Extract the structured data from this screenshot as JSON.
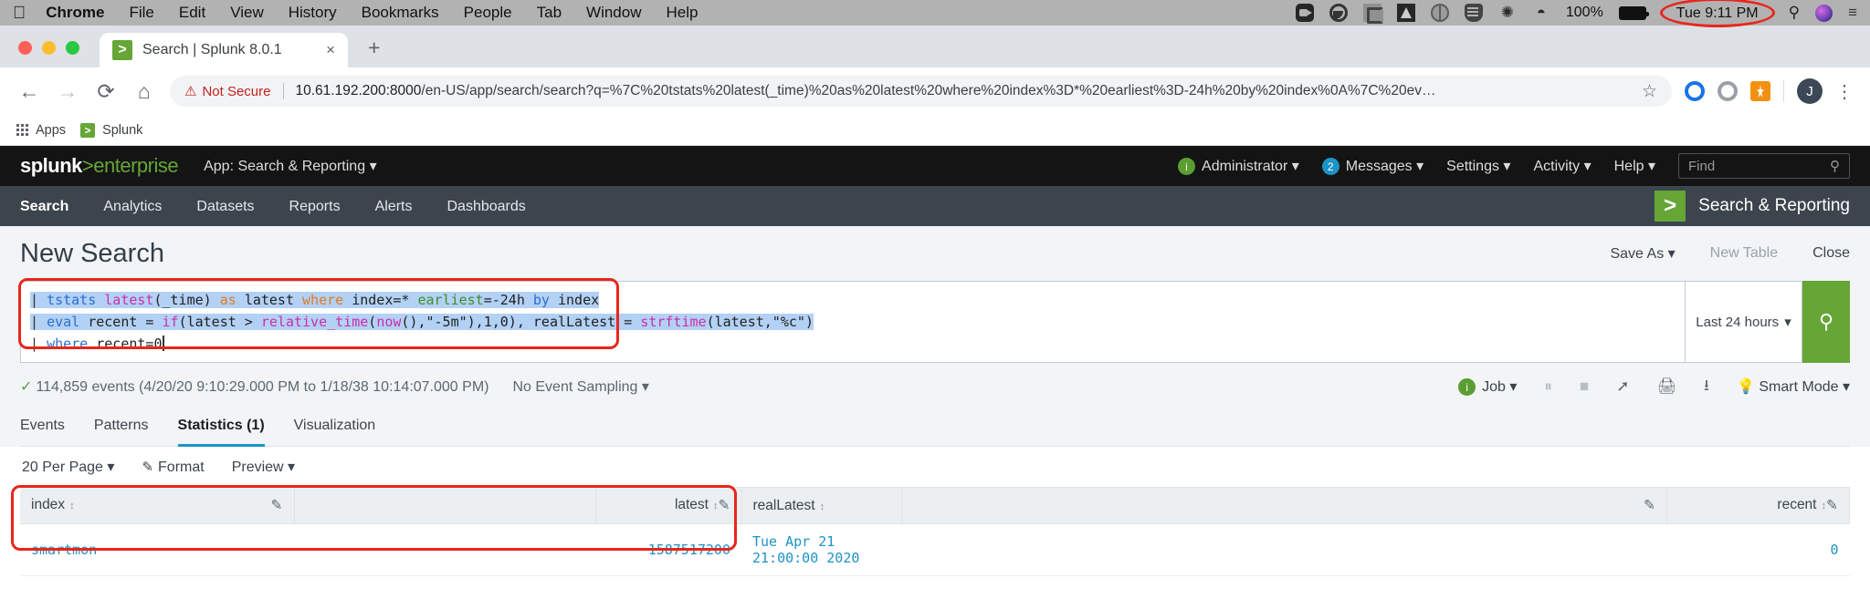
{
  "os_menubar": {
    "apple_icon": "apple-icon",
    "items": [
      "Chrome",
      "File",
      "Edit",
      "View",
      "History",
      "Bookmarks",
      "People",
      "Tab",
      "Window",
      "Help"
    ],
    "active_app": "Chrome",
    "tray_icons": [
      "zoom-icon",
      "circle-icon",
      "c-icon",
      "google-drive-icon",
      "globe-icon",
      "shield-icon",
      "bluetooth-icon",
      "wifi-icon"
    ],
    "battery_percent": "100%",
    "clock": "Tue 9:11 PM",
    "spotlight_icon": "search-icon",
    "siri_icon": "siri-icon",
    "control_center_icon": "list-icon"
  },
  "browser": {
    "tab": {
      "title": "Search | Splunk 8.0.1",
      "favicon": "splunk-favicon",
      "close": "×"
    },
    "new_tab_label": "+",
    "nav": {
      "back": "←",
      "forward": "→",
      "reload": "⟳",
      "home": "⌂"
    },
    "security_label": "Not Secure",
    "security_icon": "warning-triangle-icon",
    "url_domain": "10.61.192.200:8000",
    "url_path": "/en-US/app/search/search?q=%7C%20tstats%20latest(_time)%20as%20latest%20where%20index%3D*%20earliest%3D-24h%20by%20index%0A%7C%20ev…",
    "star_icon": "bookmark-star-icon",
    "extensions": [
      "ext-blue-icon",
      "ext-grey-icon",
      "ext-orange-icon"
    ],
    "profile_initial": "J",
    "menu_icon": "kebab-menu-icon",
    "bookmarks": [
      {
        "label": "Apps",
        "icon": "apps-grid-icon"
      },
      {
        "label": "Splunk",
        "icon": "splunk-favicon"
      }
    ]
  },
  "splunk": {
    "logo": {
      "word1": "splunk",
      "gt": ">",
      "word2": "enterprise"
    },
    "app_selector": "App: Search & Reporting",
    "header_right": [
      {
        "label": "Administrator",
        "badge": "i",
        "badge_color": "#5a9e31"
      },
      {
        "label": "Messages",
        "badge": "2",
        "badge_color": "#1e93c6"
      },
      {
        "label": "Settings",
        "badge": "",
        "badge_color": ""
      },
      {
        "label": "Activity",
        "badge": "",
        "badge_color": ""
      },
      {
        "label": "Help",
        "badge": "",
        "badge_color": ""
      }
    ],
    "find_placeholder": "Find",
    "nav_items": [
      "Search",
      "Analytics",
      "Datasets",
      "Reports",
      "Alerts",
      "Dashboards"
    ],
    "nav_active": "Search",
    "app_badge_label": "Search & Reporting",
    "app_badge_icon": ">"
  },
  "search_page": {
    "title": "New Search",
    "actions": {
      "save_as": "Save As",
      "new_table": "New Table",
      "close": "Close"
    },
    "query_lines": [
      [
        {
          "t": "| ",
          "c": "t-pipe"
        },
        {
          "t": "tstats ",
          "c": "t-cmd"
        },
        {
          "t": "latest",
          "c": "t-fn"
        },
        {
          "t": "(_time) ",
          "c": "t-plain"
        },
        {
          "t": "as ",
          "c": "t-kw"
        },
        {
          "t": "latest ",
          "c": "t-plain"
        },
        {
          "t": "where ",
          "c": "t-kw"
        },
        {
          "t": "index=* ",
          "c": "t-plain"
        },
        {
          "t": "earliest",
          "c": "t-green"
        },
        {
          "t": "=-24h ",
          "c": "t-plain"
        },
        {
          "t": "by ",
          "c": "t-by"
        },
        {
          "t": "index",
          "c": "t-plain"
        }
      ],
      [
        {
          "t": "| ",
          "c": "t-pipe"
        },
        {
          "t": "eval ",
          "c": "t-cmd"
        },
        {
          "t": "recent = ",
          "c": "t-plain"
        },
        {
          "t": "if",
          "c": "t-fn"
        },
        {
          "t": "(latest > ",
          "c": "t-plain"
        },
        {
          "t": "relative_time",
          "c": "t-fn"
        },
        {
          "t": "(",
          "c": "t-plain"
        },
        {
          "t": "now",
          "c": "t-fn"
        },
        {
          "t": "(),\"-5m\"),1,0), realLatest = ",
          "c": "t-plain"
        },
        {
          "t": "strftime",
          "c": "t-fn"
        },
        {
          "t": "(latest,\"%c\")",
          "c": "t-plain"
        }
      ],
      [
        {
          "t": "| ",
          "c": "t-pipe"
        },
        {
          "t": "where ",
          "c": "t-cmd"
        },
        {
          "t": "recent=0",
          "c": "t-plain"
        }
      ]
    ],
    "time_range": "Last 24 hours",
    "search_icon": "magnifier-icon",
    "event_count_text": "114,859 events (4/20/20 9:10:29.000 PM to 1/18/38 10:14:07.000 PM)",
    "sampling": "No Event Sampling",
    "job_label": "Job",
    "job_icons": [
      "pause-icon",
      "stop-icon",
      "share-icon",
      "print-icon",
      "download-icon"
    ],
    "mode": "Smart Mode",
    "result_tabs": [
      {
        "label": "Events"
      },
      {
        "label": "Patterns"
      },
      {
        "label": "Statistics (1)"
      },
      {
        "label": "Visualization"
      }
    ],
    "result_tab_active": "Statistics (1)",
    "table_toolbar": {
      "per_page": "20 Per Page",
      "format": "Format",
      "preview": "Preview"
    },
    "table": {
      "columns": [
        {
          "label": "index",
          "align": "left",
          "sortable": true,
          "pencil": true
        },
        {
          "label": "",
          "align": "left",
          "sortable": false,
          "pencil": false
        },
        {
          "label": "latest",
          "align": "right",
          "sortable": true,
          "pencil": true
        },
        {
          "label": "realLatest",
          "align": "left",
          "sortable": true,
          "pencil": false
        },
        {
          "label": "",
          "align": "right",
          "sortable": false,
          "pencil": true
        },
        {
          "label": "recent",
          "align": "right",
          "sortable": true,
          "pencil": true
        }
      ],
      "rows": [
        [
          "smartmon",
          "",
          "1587517200",
          "Tue Apr 21 21:00:00 2020",
          "",
          "0"
        ]
      ]
    }
  },
  "annotations": {
    "accent_red": "#e8261c",
    "highlights": [
      "clock-highlight",
      "query-highlight",
      "table-highlight"
    ]
  }
}
